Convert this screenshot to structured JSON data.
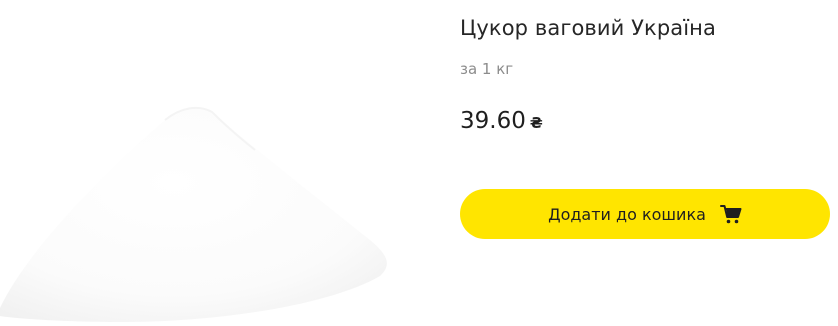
{
  "product": {
    "title": "Цукор ваговий Україна",
    "unit": "за 1 кг",
    "price": {
      "amount": "39.60",
      "currency": "₴"
    },
    "image_icon": "sugar-pile-image"
  },
  "actions": {
    "add_to_cart_label": "Додати до кошика",
    "add_to_cart_icon": "shopping-cart-icon"
  },
  "colors": {
    "accent": "#ffe500",
    "muted_text": "#8c8c8c",
    "text": "#1f1f1f"
  }
}
